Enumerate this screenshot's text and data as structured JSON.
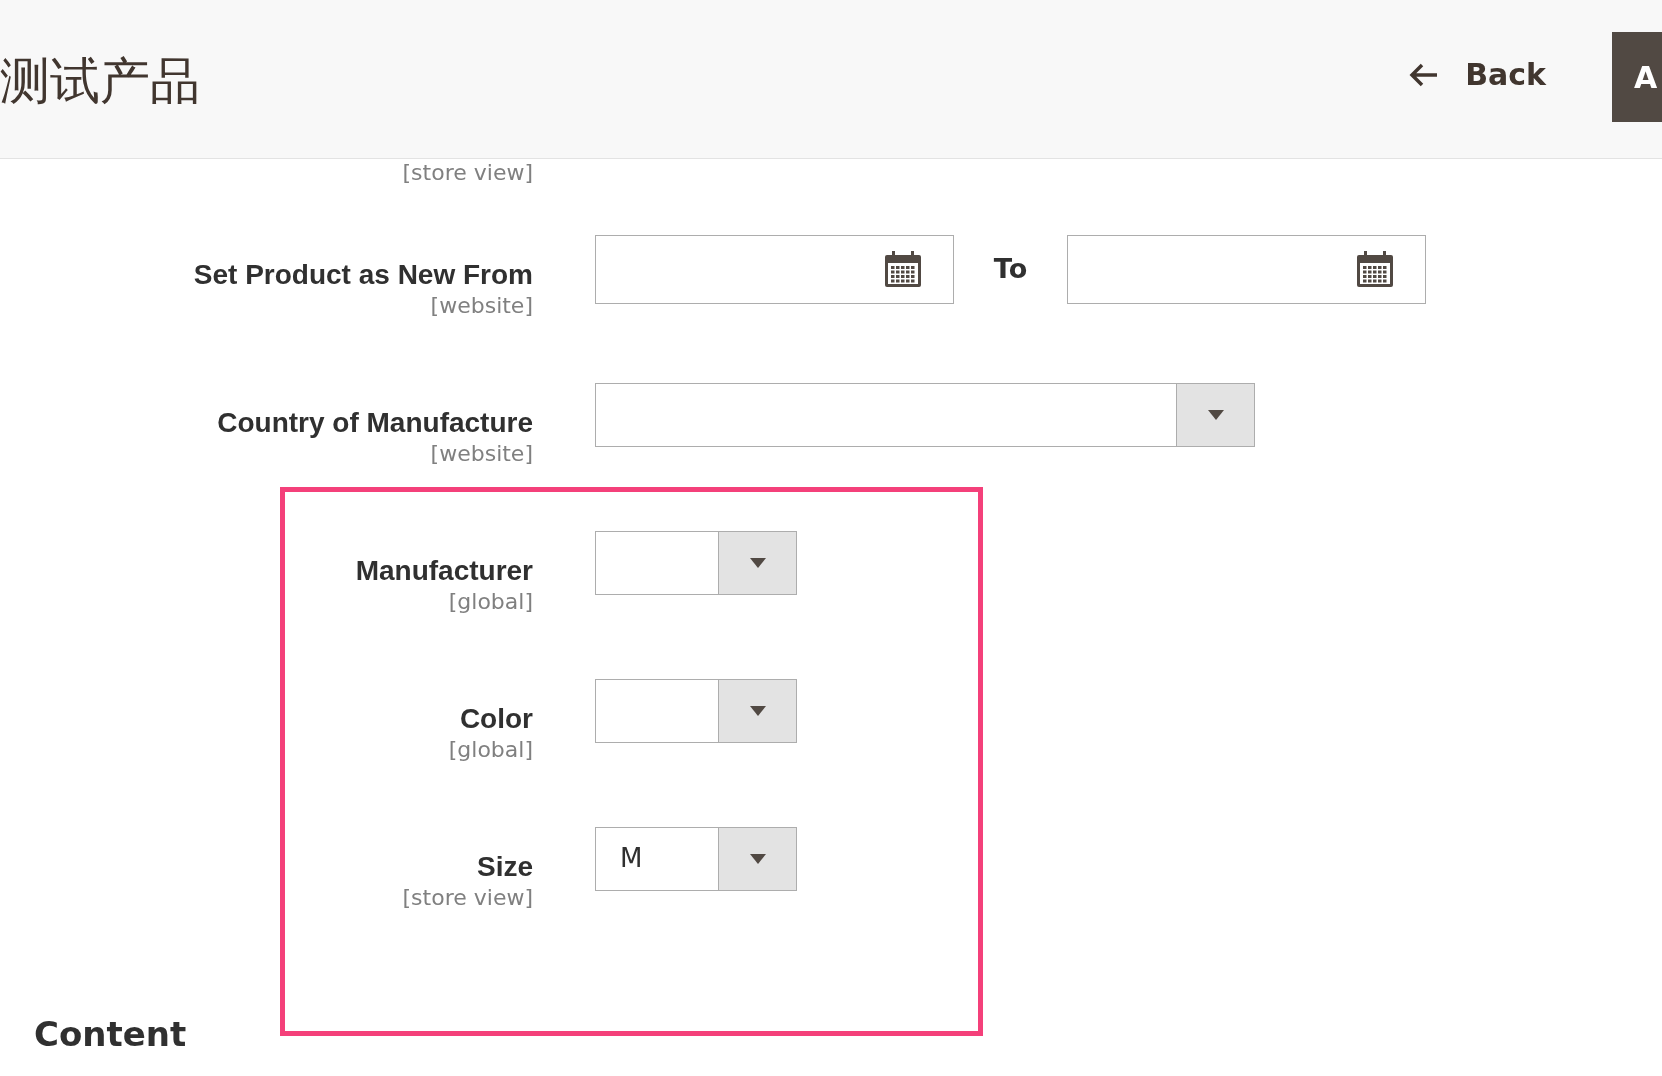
{
  "header": {
    "title": "测试产品",
    "back": "Back",
    "primary_button": "A"
  },
  "cut_scope": "[store view]",
  "fields": [
    {
      "kind": "date_range",
      "label": "Set Product as New From",
      "scope": "[website]",
      "separator": "To"
    },
    {
      "kind": "wide_select",
      "label": "Country of Manufacture",
      "scope": "[website]"
    },
    {
      "kind": "select",
      "label": "Manufacturer",
      "scope": "[global]"
    },
    {
      "kind": "select",
      "label": "Color",
      "scope": "[global]"
    },
    {
      "kind": "select",
      "label": "Size",
      "scope": "[store view]",
      "value": "M"
    }
  ],
  "section": "Content"
}
